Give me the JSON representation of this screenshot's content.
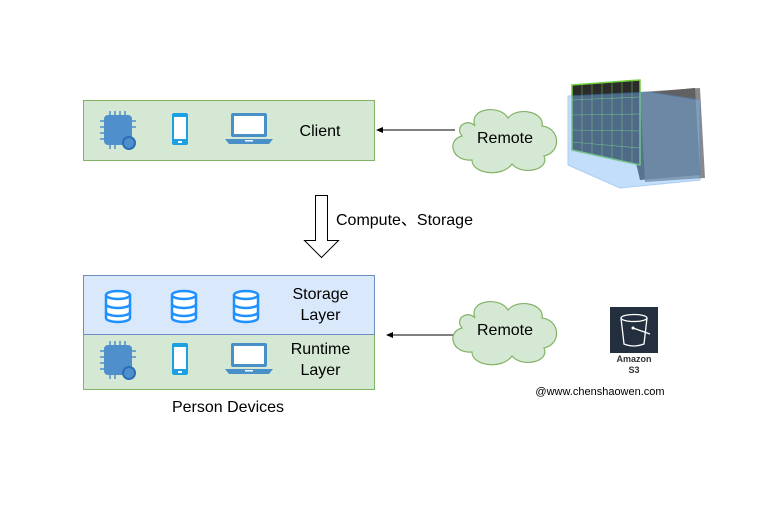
{
  "client": {
    "label": "Client"
  },
  "remote_top": {
    "label": "Remote"
  },
  "transition": {
    "label": "Compute、Storage"
  },
  "storage_layer": {
    "label_line1": "Storage",
    "label_line2": "Layer"
  },
  "runtime_layer": {
    "label_line1": "Runtime",
    "label_line2": "Layer"
  },
  "remote_bottom": {
    "label": "Remote"
  },
  "s3": {
    "label_line1": "Amazon",
    "label_line2": "S3"
  },
  "devices_caption": "Person Devices",
  "watermark": "@www.chenshaowen.com",
  "colors": {
    "green_fill": "#d5e8d4",
    "green_stroke": "#82b366",
    "blue_fill": "#dae8fc",
    "blue_stroke": "#6c8ebf",
    "icon_blue": "#4a90d9",
    "s3_bg": "#232f3e"
  }
}
